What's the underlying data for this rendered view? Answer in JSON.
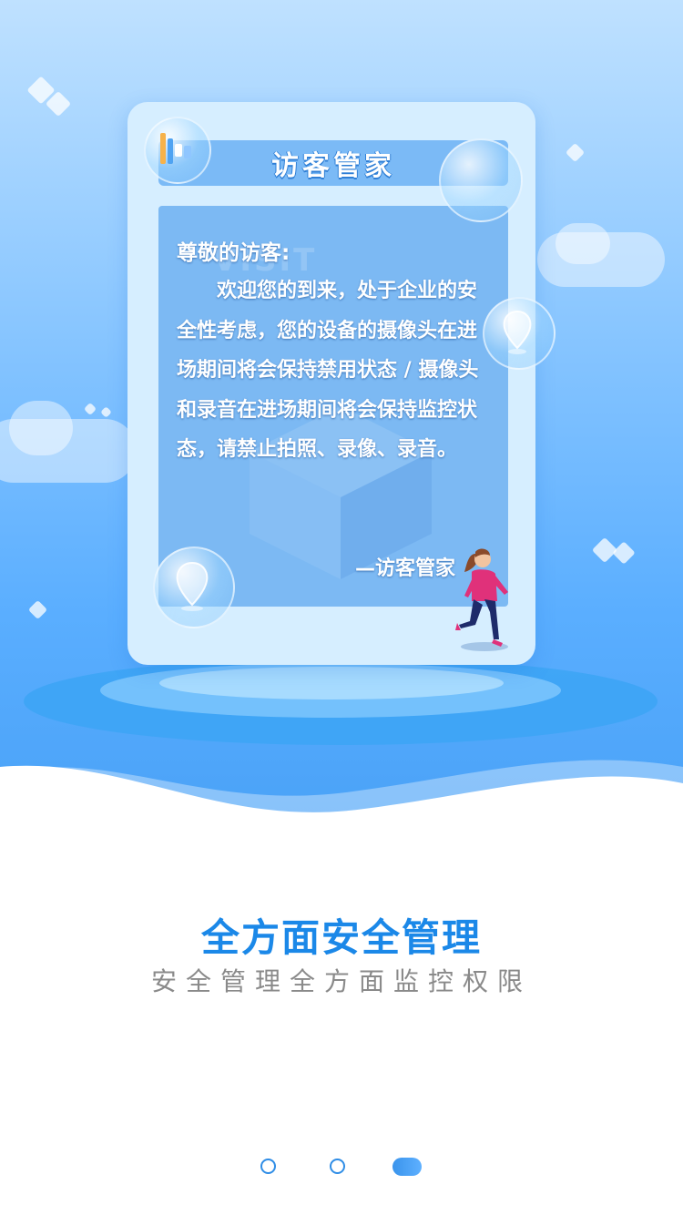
{
  "card": {
    "title": "访客管家",
    "watermark": "VISIT",
    "greeting": "尊敬的访客:",
    "body": "欢迎您的到来，处于企业的安全性考虑，您的设备的摄像头在进场期间将会保持禁用状态 / 摄像头和录音在进场期间将会保持监控状态，请禁止拍照、录像、录音。",
    "signature": "—访客管家"
  },
  "feature": {
    "headline": "全方面安全管理",
    "subline": "安全管理全方面监控权限"
  },
  "pager": {
    "total": 3,
    "active_index": 2
  },
  "colors": {
    "accent": "#1b88e8",
    "subtext": "#8a8a8a",
    "hero_top": "#bfe1ff",
    "hero_bottom": "#4aa2f7"
  },
  "icons": {
    "logo": "bar-logo-icon",
    "pin": "location-pin-icon",
    "figure": "walking-person-illustration"
  }
}
